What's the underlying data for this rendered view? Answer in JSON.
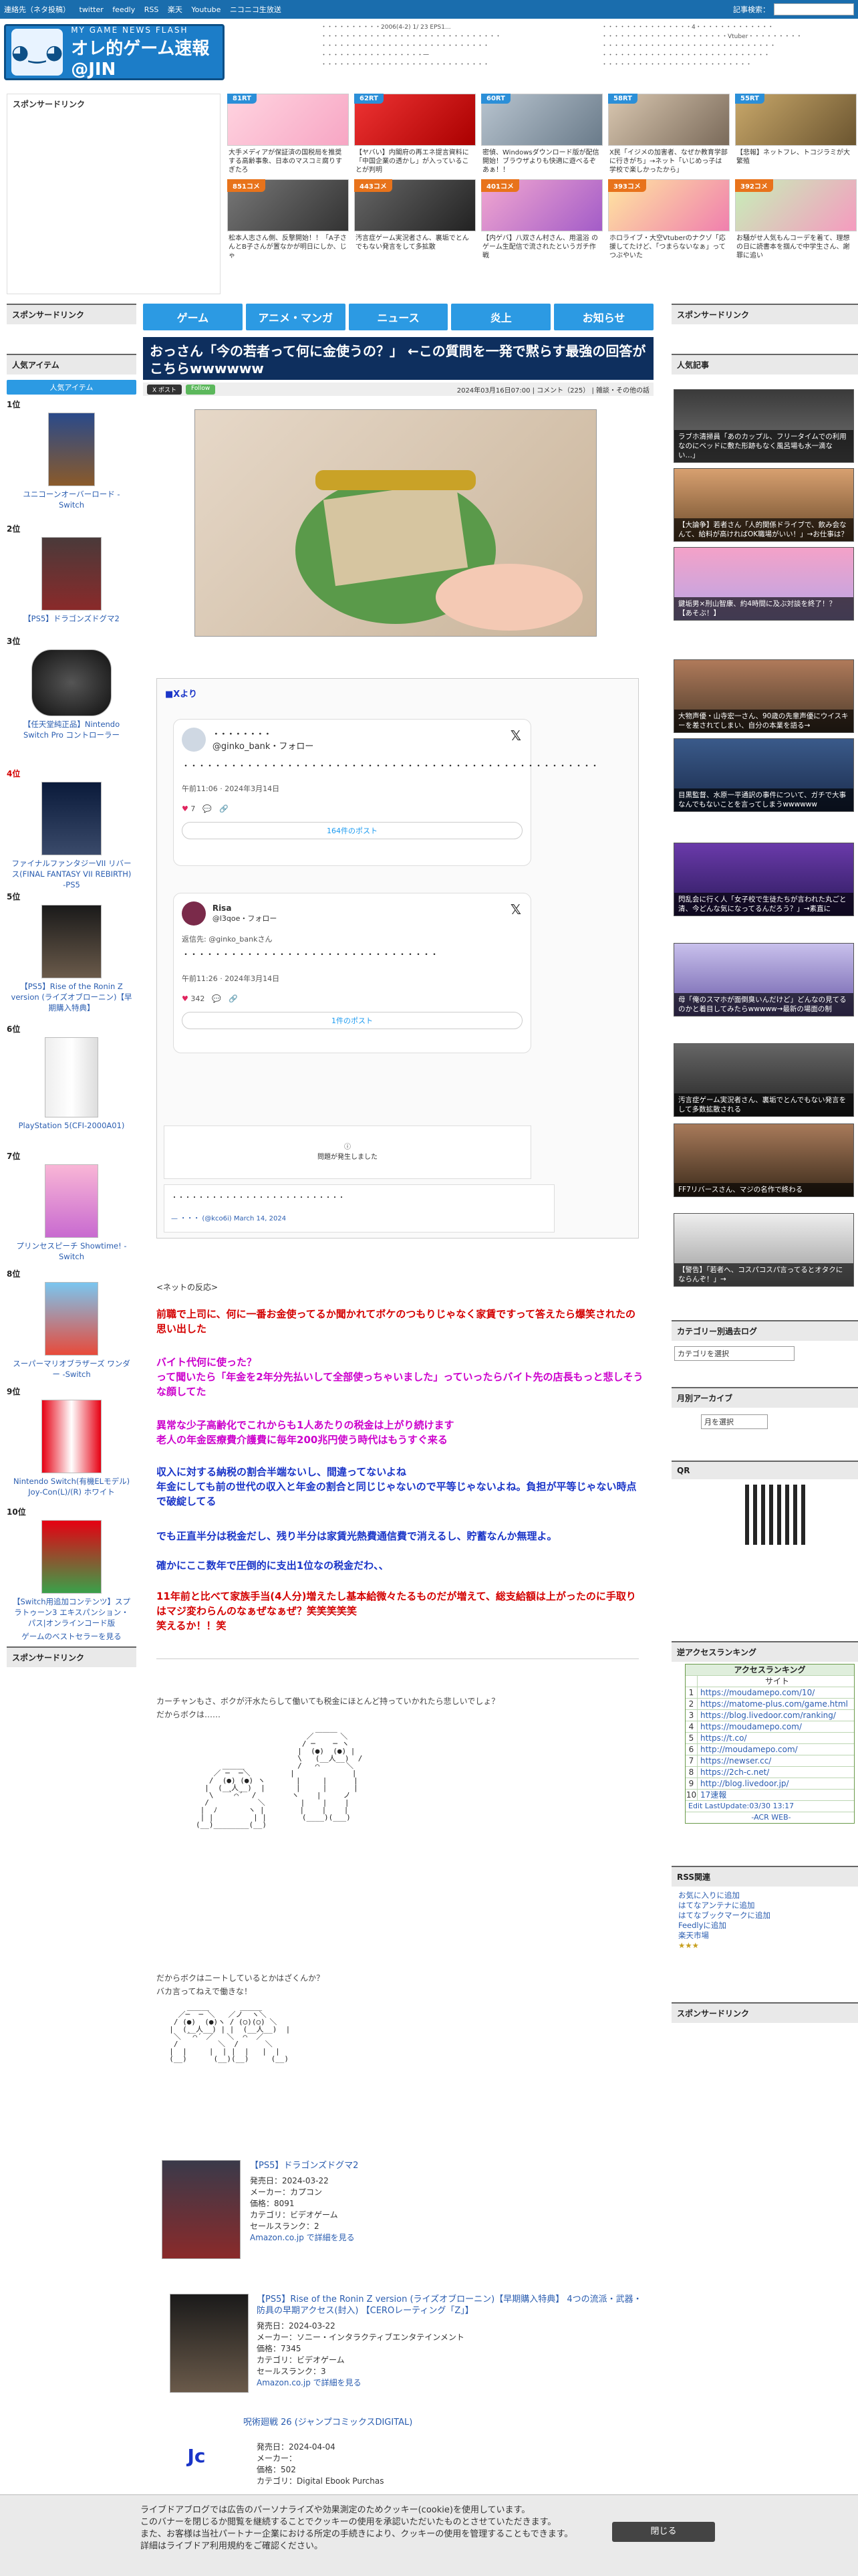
{
  "topbar": {
    "links": [
      "連絡先（ネタ投稿）",
      "twitter",
      "feedly",
      "RSS",
      "楽天",
      "Youtube",
      "ニコニコ生放送"
    ],
    "search_label": "記事検索："
  },
  "logo": {
    "sub": "MY GAME NEWS FLASH",
    "main": "オレ的ゲーム速報@JIN"
  },
  "header_news_left": [
    "・・・・・・・・・・2006(4-2) 1/ 23 EPS1...",
    "・・・・・・・・・・・・・・・・・・・・・・・・・・・・・・",
    "・・・・・・・・・・・・・・・・・・・・・・・・・・・・",
    "・・・・・・・・・・・・・・・・・一",
    "・・・・・・・・・・・・・・・・・・・・・・・・・・・・"
  ],
  "header_news_right": [
    "・・・・・・・・・・・・・・・4・・・・・・・・・・・・・",
    "・・・・・・・・・・・・・・・・・・・・・Vtuber・・・・・・・・・",
    "・・・・・・・・・・・・・・・・・・・・・・・・・・・・・",
    "・・・・・・・・・・・・・・・・・・・・・・・・・・・・",
    "・・・・・・・・・・・・・・・・・・・・・・・・・"
  ],
  "left": {
    "sponsor": "スポンサードリンク",
    "sponsor2": "スポンサードリンク",
    "sponsor3": "スポンサードリンク",
    "popular_items": "人気アイテム",
    "popular_tab": "人気アイテム",
    "ranking": [
      {
        "rank": "1位",
        "title": "ユニコーンオーバーロード - Switch"
      },
      {
        "rank": "2位",
        "title": "【PS5】ドラゴンズドグマ2"
      },
      {
        "rank": "3位",
        "title": "【任天堂純正品】Nintendo Switch Pro コントローラー"
      },
      {
        "rank": "4位",
        "title": "ファイナルファンタジーVII リバース(FINAL FANTASY VII REBIRTH) -PS5"
      },
      {
        "rank": "5位",
        "title": "【PS5】Rise of the Ronin Z version (ライズオブローニン)【早期購入特典】"
      },
      {
        "rank": "6位",
        "title": "PlayStation 5(CFI-2000A01)"
      },
      {
        "rank": "7位",
        "title": "プリンセスピーチ Showtime! -Switch"
      },
      {
        "rank": "8位",
        "title": "スーパーマリオブラザーズ ワンダー -Switch"
      },
      {
        "rank": "9位",
        "title": "Nintendo Switch(有機ELモデル) Joy-Con(L)/(R) ホワイト"
      },
      {
        "rank": "10位",
        "title": "【Switch用追加コンテンツ】スプラトゥーン3 エキスパンション・パス|オンラインコード版"
      }
    ],
    "more_link": "ゲームのベストセラーを見る"
  },
  "thumbs": [
    {
      "badge": "81RT",
      "caption": "大手メディアが保証済の国税局を推奨する高齢事象、日本のマスコミ腐りすぎたろ",
      "hot": false
    },
    {
      "badge": "62RT",
      "caption": "【ヤバい】内閣府の再エネ提言資料に「中国企業の透かし」が入っていることが判明",
      "hot": false
    },
    {
      "badge": "60RT",
      "caption": "密偵、Windowsダウンロード版が配信開始！ブラウザよりも快適に遊べるぞあぁ！！",
      "hot": false
    },
    {
      "badge": "58RT",
      "caption": "X民「イジメの加害者、なぜか教育学部に行きがち」→ネット「いじめっ子は学校で楽しかったから」",
      "hot": false
    },
    {
      "badge": "55RT",
      "caption": "【悲報】ネットフレ、トコジラミが大繁殖",
      "hot": false
    },
    {
      "badge": "851コメ",
      "caption": "松本人志さん側、反撃開始！！「A子さんとB子さんが置なかが明日にしか、じゃ",
      "hot": true
    },
    {
      "badge": "443コメ",
      "caption": "汚言症ゲーム実況者さん、裏垢でとんでもない発言をして多拡散",
      "hot": true
    },
    {
      "badge": "401コメ",
      "caption": "【内ゲバ】八双さん村さん、用温浴 のゲーム生配信で流されたというガチ作戦",
      "hot": true
    },
    {
      "badge": "393コメ",
      "caption": "ホロライブ・大空Vtuberのナクゾ「応援してたけど、「つまらないなぁ」ってつぶやいた",
      "hot": true
    },
    {
      "badge": "392コメ",
      "caption": "お騒がせ人気もんコーデを着て、理想の日に読書本を掴んで中学生さん、謝罪に追い",
      "hot": true
    }
  ],
  "nav": [
    "ゲーム",
    "アニメ・マンガ",
    "ニュース",
    "炎上",
    "お知らせ"
  ],
  "article": {
    "title": "おっさん「今の若者って何に金使うの？」 ←この質問を一発で黙らす最強の回答がこちらwwwwww",
    "date": "2024年03月16日07:00",
    "comments": "コメント（225）",
    "category": "雑談・その他の話",
    "x_btn": "X ポスト",
    "follow_btn": "Follow",
    "source_label": "■Xより",
    "tweet1": {
      "name": "・・・・・・・・",
      "handle": "@ginko_bank・フォロー",
      "text": "・・・・・・・・・・・・・・・・・・・・・・・・・・・・・・・・・・・・・・・・・・・・・・・・・・・・",
      "time": "午前11:06 · 2024年3月14日",
      "likes": "7",
      "link": "164件のポスト"
    },
    "tweet2": {
      "name": "Risa",
      "handle": "@l3qoe・フォロー",
      "reply": "返信先: @ginko_bankさん",
      "text": "・・・・・・・・・・・・・・・・・・・・・・・・・・・・・・・・",
      "time": "午前11:26 · 2024年3月14日",
      "likes": "342",
      "link": "1件のポスト"
    },
    "tweet_error": "問題が発生しました",
    "quote_text": "・・・・・・・・・・・・・・・・・・・・・・・・・・",
    "quote_by": "— ・・・ (@kco6i) March 14, 2024",
    "net_label": "<ネットの反応>",
    "reactions": [
      {
        "text": "前職で上司に、何に一番お金使ってるか聞かれてボケのつもりじゃなく家賃ですって答えたら爆笑されたの思い出した",
        "cls": "red"
      },
      {
        "text": "バイト代何に使った？\nって聞いたら「年金を2年分先払いして全部使っちゃいました」っていったらバイト先の店長もっと悲しそうな顔してた",
        "cls": "mag"
      },
      {
        "text": "異常な少子高齢化でこれからも1人あたりの税金は上がり続けます\n老人の年金医療費介護費に毎年200兆円使う時代はもうすぐ来る",
        "cls": "mag"
      },
      {
        "text": "収入に対する納税の割合半端ないし、間違ってないよね\n年金にしても前の世代の収入と年金の割合と同じじゃないので平等じゃないよね。負担が平等じゃない時点で破綻してる",
        "cls": "blue"
      },
      {
        "text": "でも正直半分は税金だし、残り半分は家賃光熱費通信費で消えるし、貯蓄なんか無理よ。",
        "cls": "blue"
      },
      {
        "text": "確かにここ数年で圧倒的に支出1位なの税金だわ、、",
        "cls": "blue"
      },
      {
        "text": "11年前と比べて家族手当(4人分)増えたし基本給微々たるものだが増えて、総支給額は上がったのに手取りはマジ変わらんのなぁぜなぁぜ？笑笑笑笑笑\n笑えるか！！笑",
        "cls": "red"
      }
    ],
    "aa_caption1": "カーチャンもさ、ボクが汗水たらして働いても税金にほとんど持っていかれたら悲しいでしょ？\nだからボクは……",
    "aa_caption2": "だからボクはニートしているとかはざくんか？\nバカ言ってねえで働きな！"
  },
  "products": [
    {
      "title": "【PS5】ドラゴンズドグマ2",
      "release": "発売日：2024-03-22",
      "maker": "メーカー：カプコン",
      "price": "価格：8091",
      "category": "カテゴリ：ビデオゲーム",
      "rank": "セールスランク：2",
      "link": "Amazon.co.jp で詳細を見る"
    },
    {
      "title": "【PS5】Rise of the Ronin Z version (ライズオブローニン)【早期購入特典】 4つの流派・武器・防具の早期アクセス(封入) 【CEROレーティング「Z」】",
      "release": "発売日：2024-03-22",
      "maker": "メーカー：ソニー・インタラクティブエンタテインメント",
      "price": "価格：7345",
      "category": "カテゴリ：ビデオゲーム",
      "rank": "セールスランク：3",
      "link": "Amazon.co.jp で詳細を見る"
    },
    {
      "title": "呪術廻戦 26 (ジャンプコミックスDIGITAL)",
      "release": "発売日：2024-04-04",
      "maker": "メーカー：",
      "price": "価格：502",
      "category": "カテゴリ：Digital Ebook Purchas",
      "rank": "",
      "link": ""
    }
  ],
  "right": {
    "sponsor": "スポンサードリンク",
    "sponsor2": "スポンサードリンク",
    "popular": "人気記事",
    "popular_items": [
      "ラブホ清掃員「あのカップル、フリータイムでの利用なのにベッドに敷た形跡もなく風呂場も水一滴ない…」",
      "【大論争】若者さん「人的関係ドライブで、飲み会なんて、給料が高ければOK職場がいい！」→お仕事は？",
      "鍵垢男×刑山智康、約4時間に及ぶ対談を終了！？【あそぶ！】",
      "大物声優・山寺宏一さん、90歳の先輩声優にウイスキーを差されてしまい、自分の本業を語る→",
      "目黒監督、水原一平通訳の事件について、ガチで大事なんでもないことを言ってしまうwwwwww",
      "閃乱会に行く人「女子校で生徒たちが言われた丸ごと清、今どんな気になってるんだろう？」→素直に",
      "母「俺のスマホが面倒臭いんだけど」どんなの見てるのかと着目してみたらwwwww→最新の場面の制",
      "汚言症ゲーム実況者さん、裏垢でとんでもない発言をして多数拡散される",
      "FF7リバースさん、マジの名作で終わる",
      "【警告】「若者へ、コスパコスパ言ってるとオタクにならんぞ！」→"
    ],
    "category_log": "カテゴリー別過去ログ",
    "category_select": "カテゴリを選択",
    "monthly": "月別アーカイブ",
    "month_select": "月を選択",
    "qr": "QR",
    "ranking": "逆アクセスランキング",
    "acr_head": "アクセスランキング",
    "acr_sub": "サイト",
    "acr_rows": [
      "https://moudamepo.com/10/",
      "https://matome-plus.com/game.html",
      "https://blog.livedoor.com/ranking/",
      "https://moudamepo.com/",
      "https://t.co/",
      "http://moudamepo.com/",
      "https://newser.cc/",
      "https://2ch-c.net/",
      "http://blog.livedoor.jp/",
      "17速報"
    ],
    "acr_update": "Edit LastUpdate:03/30 13:17",
    "acr_footer": "-ACR WEB-",
    "rss": "RSS関連",
    "rss_links": [
      "お気に入りに追加",
      "はてなアンテナに追加",
      "はてなブックマークに追加",
      "Feedlyに追加",
      "楽天市場"
    ],
    "sponsor3": "スポンサードリンク"
  },
  "cookie": {
    "text": "ライブドアブログでは広告のパーソナライズや効果測定のためクッキー(cookie)を使用しています。\nこのバナーを閉じるか閲覧を継続することでクッキーの使用を承認いただいたものとさせていただきます。\nまた、お客様は当社パートナー企業における所定の手続きにより、クッキーの使用を管理することもできます。\n詳細はライブドア利用規約をご確認ください。",
    "close": "閉じる"
  },
  "colors": {
    "accent": "#2c9ae3",
    "title_bg": "#0e2f5e",
    "topbar": "#1a6dad"
  }
}
